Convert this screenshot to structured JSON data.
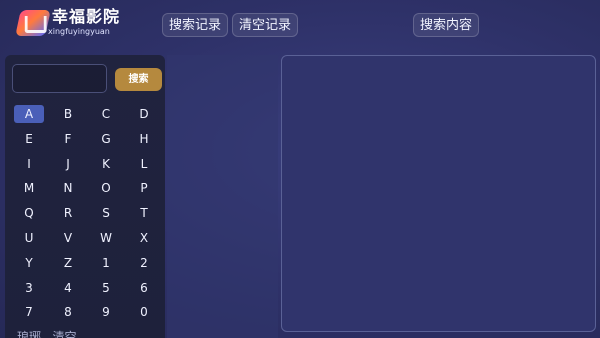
{
  "app": {
    "title": "幸福影院",
    "subtitle": "xingfuyingyuan"
  },
  "toolbar": {
    "history_label": "搜索记录",
    "clear_label": "清空记录",
    "content_label": "搜索内容"
  },
  "search": {
    "placeholder": "",
    "value": "",
    "button_label": "搜索"
  },
  "keyboard": {
    "selected": "A",
    "keys": [
      "A",
      "B",
      "C",
      "D",
      "E",
      "F",
      "G",
      "H",
      "I",
      "J",
      "K",
      "L",
      "M",
      "N",
      "O",
      "P",
      "Q",
      "R",
      "S",
      "T",
      "U",
      "V",
      "W",
      "X",
      "Y",
      "Z",
      "1",
      "2",
      "3",
      "4",
      "5",
      "6",
      "7",
      "8",
      "9",
      "0"
    ]
  },
  "history_peek": "琅琊...清空",
  "colors": {
    "accent": "#b5893e",
    "selected_key": "#4a5fb8",
    "background": "#2e3168"
  }
}
